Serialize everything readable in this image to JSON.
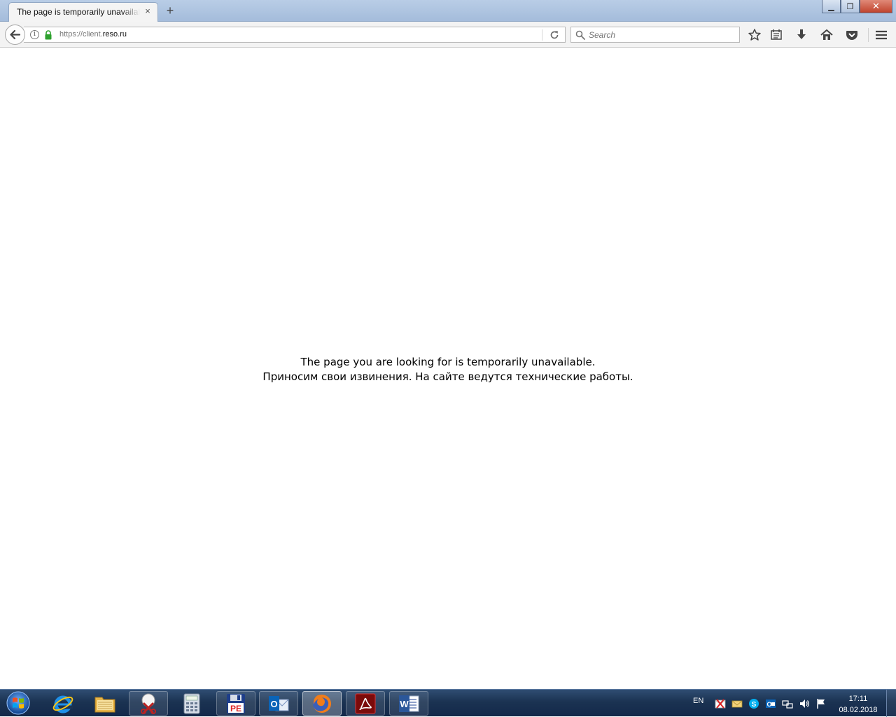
{
  "browser": {
    "tab": {
      "title": "The page is temporarily unavailable",
      "close": "×"
    },
    "new_tab": "+",
    "window_controls": {
      "minimize": "▁",
      "restore": "❐",
      "close": "✕"
    },
    "url": {
      "scheme": "https://client.",
      "host": "reso.ru"
    },
    "search": {
      "placeholder": "Search"
    },
    "toolbar_icons": [
      "bookmark-star-icon",
      "reading-list-icon",
      "downloads-icon",
      "home-icon",
      "pocket-icon",
      "menu-icon"
    ]
  },
  "page": {
    "line1": "The page you are looking for is temporarily unavailable.",
    "line2": "Приносим свои извинения. На сайте ведутся технические работы."
  },
  "taskbar": {
    "apps": [
      "internet-explorer-icon",
      "file-explorer-icon",
      "snipping-tool-icon",
      "calculator-icon",
      "pe-save-icon",
      "outlook-icon",
      "firefox-icon",
      "acrobat-icon",
      "word-icon"
    ],
    "tray": {
      "language": "EN"
    },
    "clock": {
      "time": "17:11",
      "date": "08.02.2018"
    }
  },
  "colors": {
    "taskbar": "#1b3352",
    "titlebar": "#a4bcdb",
    "lock_green": "#2ea12e"
  }
}
